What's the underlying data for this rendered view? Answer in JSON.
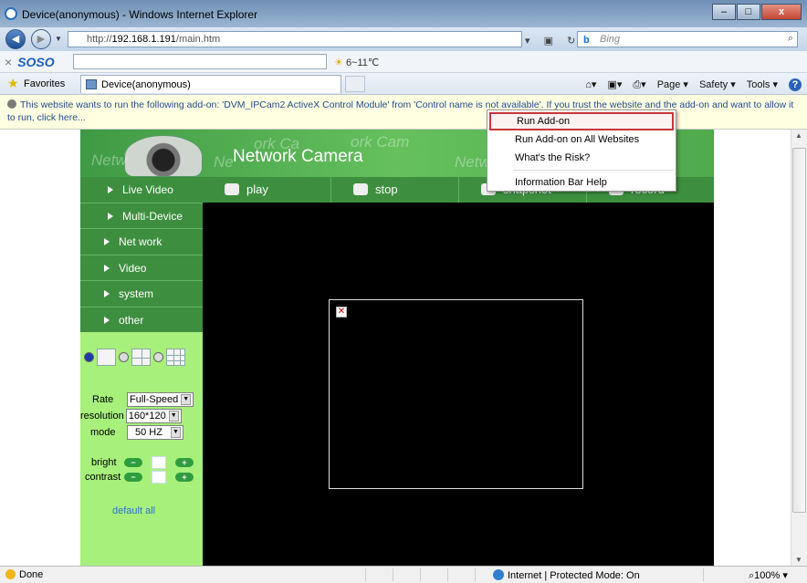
{
  "window": {
    "title": "Device(anonymous) - Windows Internet Explorer",
    "min": "–",
    "max": "□",
    "close": "x"
  },
  "address": {
    "prefix": "http://",
    "host": "192.168.1.191",
    "path": "/main.htm",
    "search_placeholder": "Bing",
    "search_brand": "b"
  },
  "soso": {
    "close": "×",
    "logo": "SOSO",
    "weather": "6~11℃"
  },
  "favorites": {
    "label": "Favorites",
    "tab_title": "Device(anonymous)"
  },
  "commands": {
    "page": "Page ▾",
    "safety": "Safety ▾",
    "tools": "Tools ▾",
    "help": "?"
  },
  "infobar": {
    "message": "This website wants to run the following add-on: 'DVM_IPCam2 ActiveX Control Module' from 'Control name is not available'. If you trust the website and the add-on and want to allow it to run, click here..."
  },
  "popup": {
    "items": [
      "Run Add-on",
      "Run Add-on on All Websites",
      "What's the Risk?",
      "Information Bar Help"
    ]
  },
  "camera": {
    "title": "Network Camera",
    "watermark": "Network Camera",
    "menu": [
      "Live Video",
      "Multi-Device",
      "Net work",
      "Video",
      "system",
      "other"
    ],
    "controls": [
      "play",
      "stop",
      "snapshot",
      "record"
    ],
    "rate_label": "Rate",
    "rate_value": "Full-Speed",
    "resolution_label": "resolution",
    "resolution_value": "160*120",
    "mode_label": "mode",
    "mode_value": "50 HZ",
    "bright_label": "bright",
    "contrast_label": "contrast",
    "minus": "−",
    "plus": "+",
    "default_all": "default all"
  },
  "status": {
    "left": "Done",
    "zone": "Internet | Protected Mode: On",
    "zoom": "100%"
  },
  "colors": {
    "banner": "#4eaa4c",
    "menu": "#3d8f3f",
    "side": "#a7f07b",
    "infobar": "#ffffe1"
  }
}
